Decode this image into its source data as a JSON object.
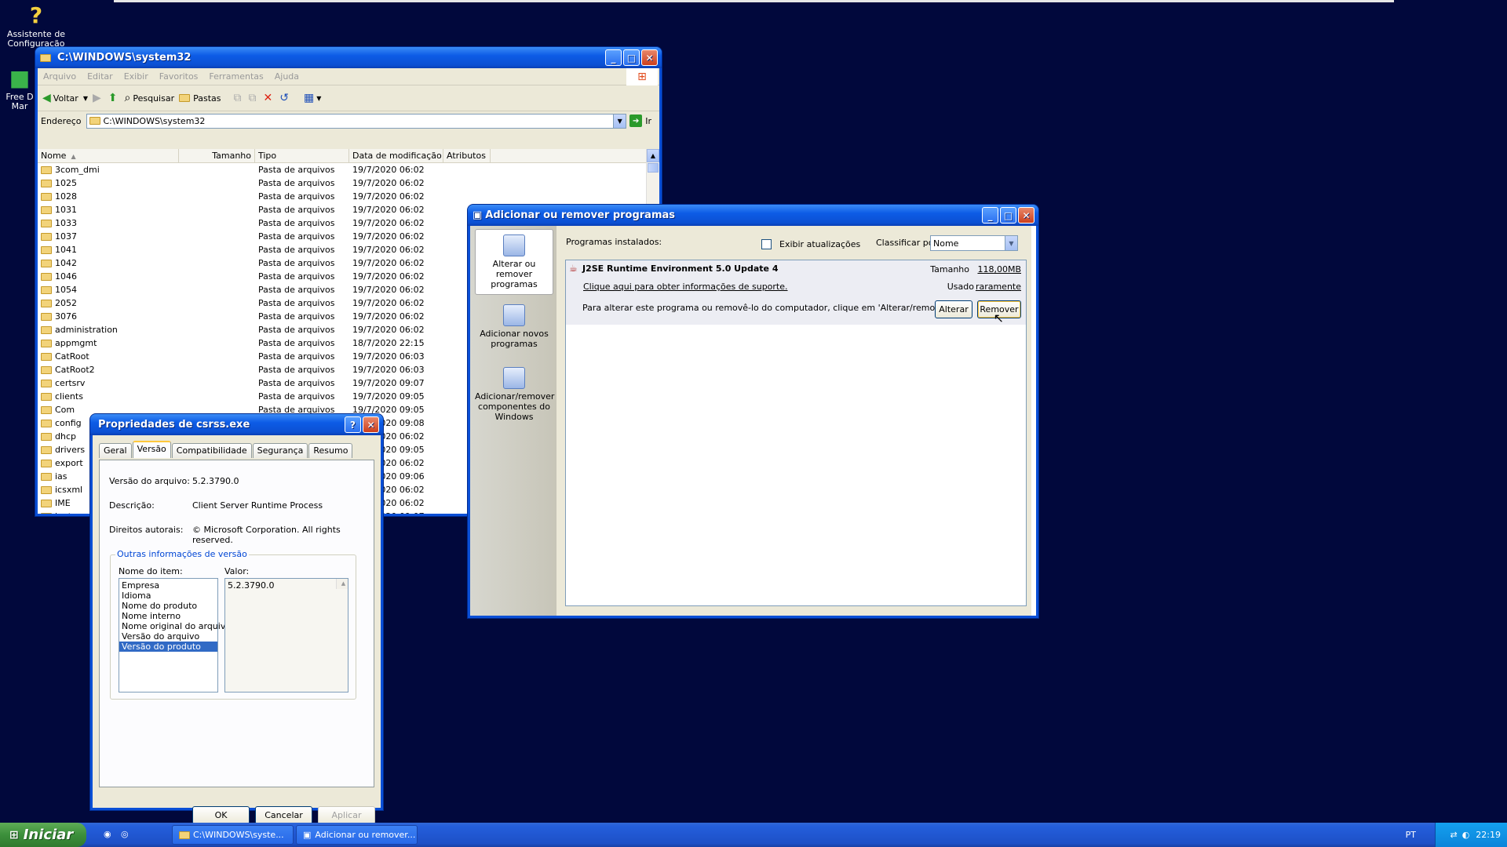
{
  "desktop": {
    "icons": [
      {
        "label": "Assistente de Configuração"
      },
      {
        "label": "Free D Mar"
      }
    ]
  },
  "explorer": {
    "title": "C:\\WINDOWS\\system32",
    "menu": [
      "Arquivo",
      "Editar",
      "Exibir",
      "Favoritos",
      "Ferramentas",
      "Ajuda"
    ],
    "toolbar": {
      "back": "Voltar",
      "search": "Pesquisar",
      "folders": "Pastas"
    },
    "address": {
      "label": "Endereço",
      "value": "C:\\WINDOWS\\system32",
      "go": "Ir"
    },
    "columns": [
      "Nome",
      "Tamanho",
      "Tipo",
      "Data de modificação",
      "Atributos"
    ],
    "rows": [
      {
        "name": "3com_dmi",
        "type": "Pasta de arquivos",
        "date": "19/7/2020 06:02"
      },
      {
        "name": "1025",
        "type": "Pasta de arquivos",
        "date": "19/7/2020 06:02"
      },
      {
        "name": "1028",
        "type": "Pasta de arquivos",
        "date": "19/7/2020 06:02"
      },
      {
        "name": "1031",
        "type": "Pasta de arquivos",
        "date": "19/7/2020 06:02"
      },
      {
        "name": "1033",
        "type": "Pasta de arquivos",
        "date": "19/7/2020 06:02"
      },
      {
        "name": "1037",
        "type": "Pasta de arquivos",
        "date": "19/7/2020 06:02"
      },
      {
        "name": "1041",
        "type": "Pasta de arquivos",
        "date": "19/7/2020 06:02"
      },
      {
        "name": "1042",
        "type": "Pasta de arquivos",
        "date": "19/7/2020 06:02"
      },
      {
        "name": "1046",
        "type": "Pasta de arquivos",
        "date": "19/7/2020 06:02"
      },
      {
        "name": "1054",
        "type": "Pasta de arquivos",
        "date": "19/7/2020 06:02"
      },
      {
        "name": "2052",
        "type": "Pasta de arquivos",
        "date": "19/7/2020 06:02"
      },
      {
        "name": "3076",
        "type": "Pasta de arquivos",
        "date": "19/7/2020 06:02"
      },
      {
        "name": "administration",
        "type": "Pasta de arquivos",
        "date": "19/7/2020 06:02"
      },
      {
        "name": "appmgmt",
        "type": "Pasta de arquivos",
        "date": "18/7/2020 22:15"
      },
      {
        "name": "CatRoot",
        "type": "Pasta de arquivos",
        "date": "19/7/2020 06:03"
      },
      {
        "name": "CatRoot2",
        "type": "Pasta de arquivos",
        "date": "19/7/2020 06:03"
      },
      {
        "name": "certsrv",
        "type": "Pasta de arquivos",
        "date": "19/7/2020 09:07"
      },
      {
        "name": "clients",
        "type": "Pasta de arquivos",
        "date": "19/7/2020 09:05"
      },
      {
        "name": "Com",
        "type": "Pasta de arquivos",
        "date": "19/7/2020 09:05"
      },
      {
        "name": "config",
        "type": "Pasta de arquivos",
        "date": "19/7/2020 09:08"
      },
      {
        "name": "dhcp",
        "type": "",
        "date": "19/7/2020 06:02"
      },
      {
        "name": "drivers",
        "type": "",
        "date": "19/7/2020 09:05"
      },
      {
        "name": "export",
        "type": "",
        "date": "19/7/2020 06:02"
      },
      {
        "name": "ias",
        "type": "",
        "date": "19/7/2020 09:06"
      },
      {
        "name": "icsxml",
        "type": "",
        "date": "19/7/2020 06:02"
      },
      {
        "name": "IME",
        "type": "",
        "date": "19/7/2020 06:02"
      },
      {
        "name": "inetsrv",
        "type": "",
        "date": "19/7/2020 09:07"
      }
    ]
  },
  "addremove": {
    "title": "Adicionar ou remover programas",
    "sidebar": [
      "Alterar ou remover programas",
      "Adicionar novos programas",
      "Adicionar/remover componentes do Windows"
    ],
    "installed_label": "Programas instalados:",
    "show_updates": "Exibir atualizações",
    "sort_label": "Classificar por:",
    "sort_value": "Nome",
    "program": {
      "name": "J2SE Runtime Environment 5.0 Update 4",
      "size_label": "Tamanho",
      "size_value": "118,00MB",
      "support_link": "Clique aqui para obter informações de suporte.",
      "used_label": "Usado",
      "used_value": "raramente",
      "hint": "Para alterar este programa ou removê-lo do computador, clique em 'Alterar/remover'.",
      "change": "Alterar",
      "remove": "Remover"
    }
  },
  "props": {
    "title": "Propriedades de csrss.exe",
    "tabs": [
      "Geral",
      "Versão",
      "Compatibilidade",
      "Segurança",
      "Resumo"
    ],
    "file_version_label": "Versão do arquivo:",
    "file_version": "5.2.3790.0",
    "desc_label": "Descrição:",
    "desc": "Client Server Runtime Process",
    "copyright_label": "Direitos autorais:",
    "copyright": "© Microsoft Corporation. All rights reserved.",
    "group_label": "Outras informações de versão",
    "item_label": "Nome do item:",
    "value_label": "Valor:",
    "items": [
      "Empresa",
      "Idioma",
      "Nome do produto",
      "Nome interno",
      "Nome original do arquivo",
      "Versão do arquivo",
      "Versão do produto"
    ],
    "value": "5.2.3790.0",
    "ok": "OK",
    "cancel": "Cancelar",
    "apply": "Aplicar"
  },
  "taskbar": {
    "start": "Iniciar",
    "tasks": [
      "C:\\WINDOWS\\syste...",
      "Adicionar ou remover..."
    ],
    "lang": "PT",
    "clock": "22:19"
  }
}
